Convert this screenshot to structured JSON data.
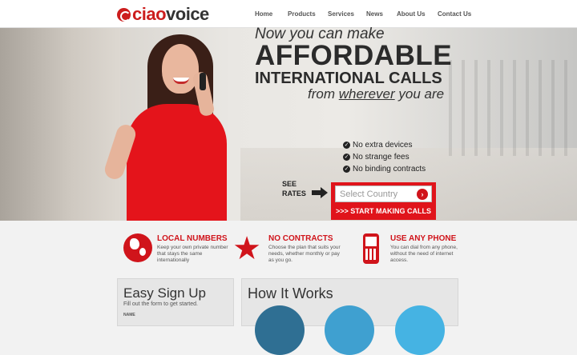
{
  "header": {
    "logo_ciao": "ciao",
    "logo_voice": "voice",
    "nav": [
      "Home",
      "Products",
      "Services",
      "News",
      "About Us",
      "Contact Us"
    ]
  },
  "hero": {
    "line1": "Now you can make",
    "line2": "AFFORDABLE",
    "line3": "INTERNATIONAL CALLS",
    "line4_pre": "from",
    "line4_em": "wherever",
    "line4_post": "you are",
    "features": [
      "No extra devices",
      "No strange fees",
      "No binding contracts"
    ],
    "see_rates_1": "SEE",
    "see_rates_2": "RATES",
    "select_placeholder": "Select Country",
    "cta": ">>> START MAKING CALLS"
  },
  "info": [
    {
      "title": "LOCAL NUMBERS",
      "desc": "Keep your own private number that stays the same internationally",
      "icon": "globe-icon"
    },
    {
      "title": "NO CONTRACTS",
      "desc": "Choose the plan that suits your needs, whether monthly or pay as you go.",
      "icon": "star-icon"
    },
    {
      "title": "USE ANY PHONE",
      "desc": "You can dial from any phone, without the need of internet access.",
      "icon": "phone-icon"
    }
  ],
  "signup": {
    "title": "Easy Sign Up",
    "subtitle": "Fill out the form to get started.",
    "name_label": "NAME"
  },
  "how": {
    "title": "How It Works"
  },
  "colors": {
    "brand_red": "#d0141b",
    "how_blue": "#3a8fc8"
  }
}
